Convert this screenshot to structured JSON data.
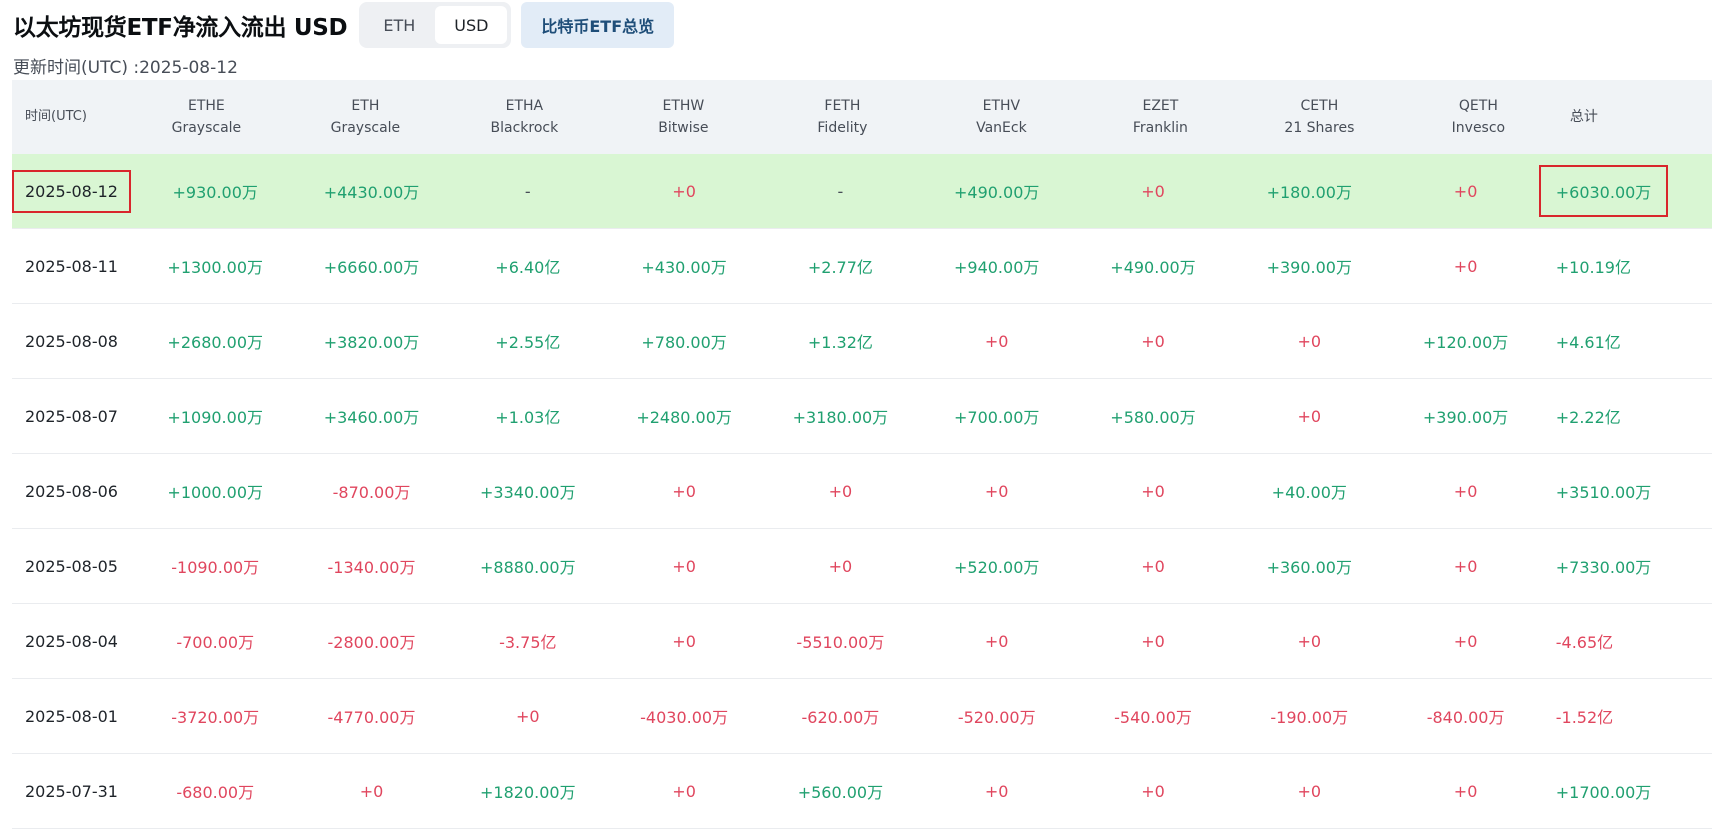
{
  "header": {
    "title": "以太坊现货ETF净流入流出 USD",
    "toggle": [
      {
        "label": "ETH",
        "active": false
      },
      {
        "label": "USD",
        "active": true
      }
    ],
    "overview_label": "比特币ETF总览",
    "updated": "更新时间(UTC) :2025-08-12"
  },
  "table": {
    "date_header": "时间(UTC)",
    "total_header": "总计",
    "columns": [
      {
        "ticker": "ETHE",
        "issuer": "Grayscale"
      },
      {
        "ticker": "ETH",
        "issuer": "Grayscale"
      },
      {
        "ticker": "ETHA",
        "issuer": "Blackrock"
      },
      {
        "ticker": "ETHW",
        "issuer": "Bitwise"
      },
      {
        "ticker": "FETH",
        "issuer": "Fidelity"
      },
      {
        "ticker": "ETHV",
        "issuer": "VanEck"
      },
      {
        "ticker": "EZET",
        "issuer": "Franklin"
      },
      {
        "ticker": "CETH",
        "issuer": "21 Shares"
      },
      {
        "ticker": "QETH",
        "issuer": "Invesco"
      }
    ],
    "rows": [
      {
        "date": "2025-08-12",
        "values": [
          "+930.00万",
          "+4430.00万",
          "-",
          "+0",
          "-",
          "+490.00万",
          "+0",
          "+180.00万",
          "+0"
        ],
        "total": "+6030.00万"
      },
      {
        "date": "2025-08-11",
        "values": [
          "+1300.00万",
          "+6660.00万",
          "+6.40亿",
          "+430.00万",
          "+2.77亿",
          "+940.00万",
          "+490.00万",
          "+390.00万",
          "+0"
        ],
        "total": "+10.19亿"
      },
      {
        "date": "2025-08-08",
        "values": [
          "+2680.00万",
          "+3820.00万",
          "+2.55亿",
          "+780.00万",
          "+1.32亿",
          "+0",
          "+0",
          "+0",
          "+120.00万"
        ],
        "total": "+4.61亿"
      },
      {
        "date": "2025-08-07",
        "values": [
          "+1090.00万",
          "+3460.00万",
          "+1.03亿",
          "+2480.00万",
          "+3180.00万",
          "+700.00万",
          "+580.00万",
          "+0",
          "+390.00万"
        ],
        "total": "+2.22亿"
      },
      {
        "date": "2025-08-06",
        "values": [
          "+1000.00万",
          "-870.00万",
          "+3340.00万",
          "+0",
          "+0",
          "+0",
          "+0",
          "+40.00万",
          "+0"
        ],
        "total": "+3510.00万"
      },
      {
        "date": "2025-08-05",
        "values": [
          "-1090.00万",
          "-1340.00万",
          "+8880.00万",
          "+0",
          "+0",
          "+520.00万",
          "+0",
          "+360.00万",
          "+0"
        ],
        "total": "+7330.00万"
      },
      {
        "date": "2025-08-04",
        "values": [
          "-700.00万",
          "-2800.00万",
          "-3.75亿",
          "+0",
          "-5510.00万",
          "+0",
          "+0",
          "+0",
          "+0"
        ],
        "total": "-4.65亿"
      },
      {
        "date": "2025-08-01",
        "values": [
          "-3720.00万",
          "-4770.00万",
          "+0",
          "-4030.00万",
          "-620.00万",
          "-520.00万",
          "-540.00万",
          "-190.00万",
          "-840.00万"
        ],
        "total": "-1.52亿"
      },
      {
        "date": "2025-07-31",
        "values": [
          "-680.00万",
          "+0",
          "+1820.00万",
          "+0",
          "+560.00万",
          "+0",
          "+0",
          "+0",
          "+0"
        ],
        "total": "+1700.00万"
      }
    ]
  },
  "colors": {
    "positive": "#20a070",
    "negative": "#e0465e",
    "neutral": "#474d57",
    "highlight_row": "#d9f6d3",
    "header_bg": "#f0f3f6",
    "annotation_box": "#d9262c"
  }
}
